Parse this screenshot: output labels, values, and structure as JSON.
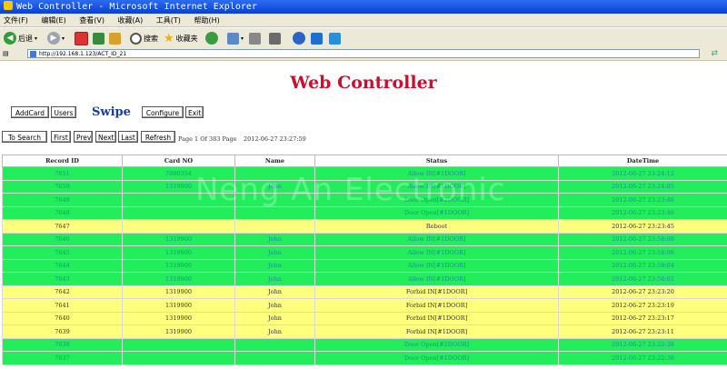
{
  "window": {
    "title": "Web Controller - Microsoft Internet Explorer"
  },
  "menu": [
    "文件(F)",
    "编辑(E)",
    "查看(V)",
    "收藏(A)",
    "工具(T)",
    "帮助(H)"
  ],
  "toolbar": {
    "back_label": "后退",
    "search_label": "搜索",
    "favorites_label": "收藏夹"
  },
  "address": {
    "url": "http://192.168.1.123/ACT_ID_21"
  },
  "page": {
    "title": "Web Controller",
    "nav": {
      "addcard": "AddCard",
      "users": "Users",
      "swipe": "Swipe",
      "configure": "Configure",
      "exit": "Exit"
    },
    "controls": {
      "to_search": "To Search",
      "first": "First",
      "prev": "Prev",
      "next": "Next",
      "last": "Last",
      "refresh": "Refresh"
    },
    "page_info": "Page 1 Of 383 Page",
    "now": "2012-06-27 23:27:59",
    "watermark": "Neng An Electronic"
  },
  "table": {
    "headers": [
      "Record ID",
      "Card NO",
      "Name",
      "Status",
      "DateTime"
    ],
    "rows": [
      {
        "id": "7651",
        "card": "7890354",
        "name": "",
        "status": "Allow IN[#1DOOR]",
        "time": "2012-06-27 23:24:12",
        "color": "green"
      },
      {
        "id": "7650",
        "card": "1319900",
        "name": "John",
        "status": "Allow IN[#1DOOR]",
        "time": "2012-06-27 23:24:05",
        "color": "green"
      },
      {
        "id": "7649",
        "card": "",
        "name": "",
        "status": "Door Open[#2DOOR]",
        "time": "2012-06-27 23:23:48",
        "color": "green"
      },
      {
        "id": "7648",
        "card": "",
        "name": "",
        "status": "Door Open[#1DOOR]",
        "time": "2012-06-27 23:23:48",
        "color": "green"
      },
      {
        "id": "7647",
        "card": "",
        "name": "",
        "status": "Reboot",
        "time": "2012-06-27 23:23:45",
        "color": "yellow"
      },
      {
        "id": "7646",
        "card": "1319900",
        "name": "John",
        "status": "Allow IN[#1DOOR]",
        "time": "2012-06-27 23:58:08",
        "color": "green"
      },
      {
        "id": "7645",
        "card": "1319900",
        "name": "John",
        "status": "Allow IN[#1DOOR]",
        "time": "2012-06-27 23:58:08",
        "color": "green"
      },
      {
        "id": "7644",
        "card": "1319900",
        "name": "John",
        "status": "Allow IN[#1DOOR]",
        "time": "2012-06-27 23:58:04",
        "color": "green"
      },
      {
        "id": "7643",
        "card": "1319900",
        "name": "John",
        "status": "Allow IN[#1DOOR]",
        "time": "2012-06-27 23:58:02",
        "color": "green"
      },
      {
        "id": "7642",
        "card": "1319900",
        "name": "John",
        "status": "Forbid IN[#1DOOR]",
        "time": "2012-06-27 23:23:20",
        "color": "yellow"
      },
      {
        "id": "7641",
        "card": "1319900",
        "name": "John",
        "status": "Forbid IN[#1DOOR]",
        "time": "2012-06-27 23:23:19",
        "color": "yellow"
      },
      {
        "id": "7640",
        "card": "1319900",
        "name": "John",
        "status": "Forbid IN[#1DOOR]",
        "time": "2012-06-27 23:23:17",
        "color": "yellow"
      },
      {
        "id": "7639",
        "card": "1319900",
        "name": "John",
        "status": "Forbid IN[#1DOOR]",
        "time": "2012-06-27 23:23:11",
        "color": "yellow"
      },
      {
        "id": "7638",
        "card": "",
        "name": "",
        "status": "Door Open[#2DOOR]",
        "time": "2012-06-27 23:22:38",
        "color": "green"
      },
      {
        "id": "7637",
        "card": "",
        "name": "",
        "status": "Door Open[#1DOOR]",
        "time": "2012-06-27 23:22:38",
        "color": "green"
      }
    ]
  },
  "colors": {
    "title_red": "#c8102e",
    "row_green": "#22ee5c",
    "row_yellow": "#ffff7e",
    "swipe_blue": "#1a3d9a"
  }
}
